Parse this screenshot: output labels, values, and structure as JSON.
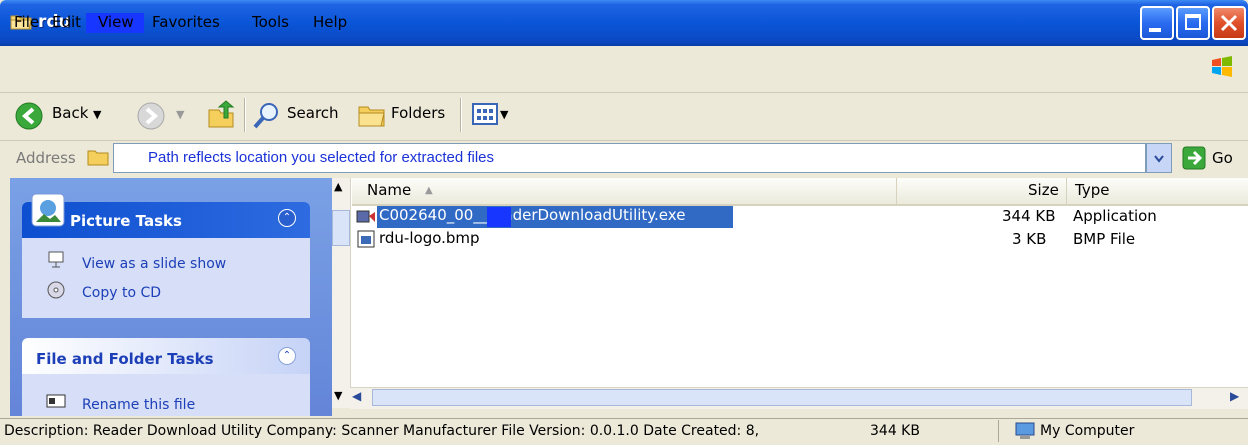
{
  "window": {
    "title": "rdu"
  },
  "menu": [
    "File",
    "Edit",
    "View",
    "Favorites",
    "Tools",
    "Help"
  ],
  "toolbar": {
    "back": "Back",
    "search": "Search",
    "folders": "Folders"
  },
  "address": {
    "label": "Address",
    "value": "Path reflects location you selected for extracted files",
    "go": "Go"
  },
  "left_pane": {
    "picture_tasks": {
      "title": "Picture Tasks",
      "items": [
        "View as a slide show",
        "Copy to CD"
      ]
    },
    "file_tasks": {
      "title": "File and Folder Tasks",
      "items": [
        "Rename this file"
      ]
    }
  },
  "file_list": {
    "columns": {
      "name": "Name",
      "size": "Size",
      "type": "Type"
    },
    "rows": [
      {
        "name": "C002640_00__readerDownloadUtility.exe",
        "size": "344 KB",
        "type": "Application",
        "selected": true
      },
      {
        "name": "rdu-logo.bmp",
        "size": "3 KB",
        "type": "BMP File",
        "selected": false
      }
    ]
  },
  "status": {
    "description": "Description: Reader Download Utility Company: Scanner Manufacturer File Version: 0.0.1.0 Date Created: 8,",
    "size": "344 KB",
    "location": "My Computer"
  },
  "colors": {
    "title_bar": "#0a55d8",
    "selection": "#316ac5",
    "redaction": "#1736ff",
    "address_text": "#1a32d8"
  }
}
